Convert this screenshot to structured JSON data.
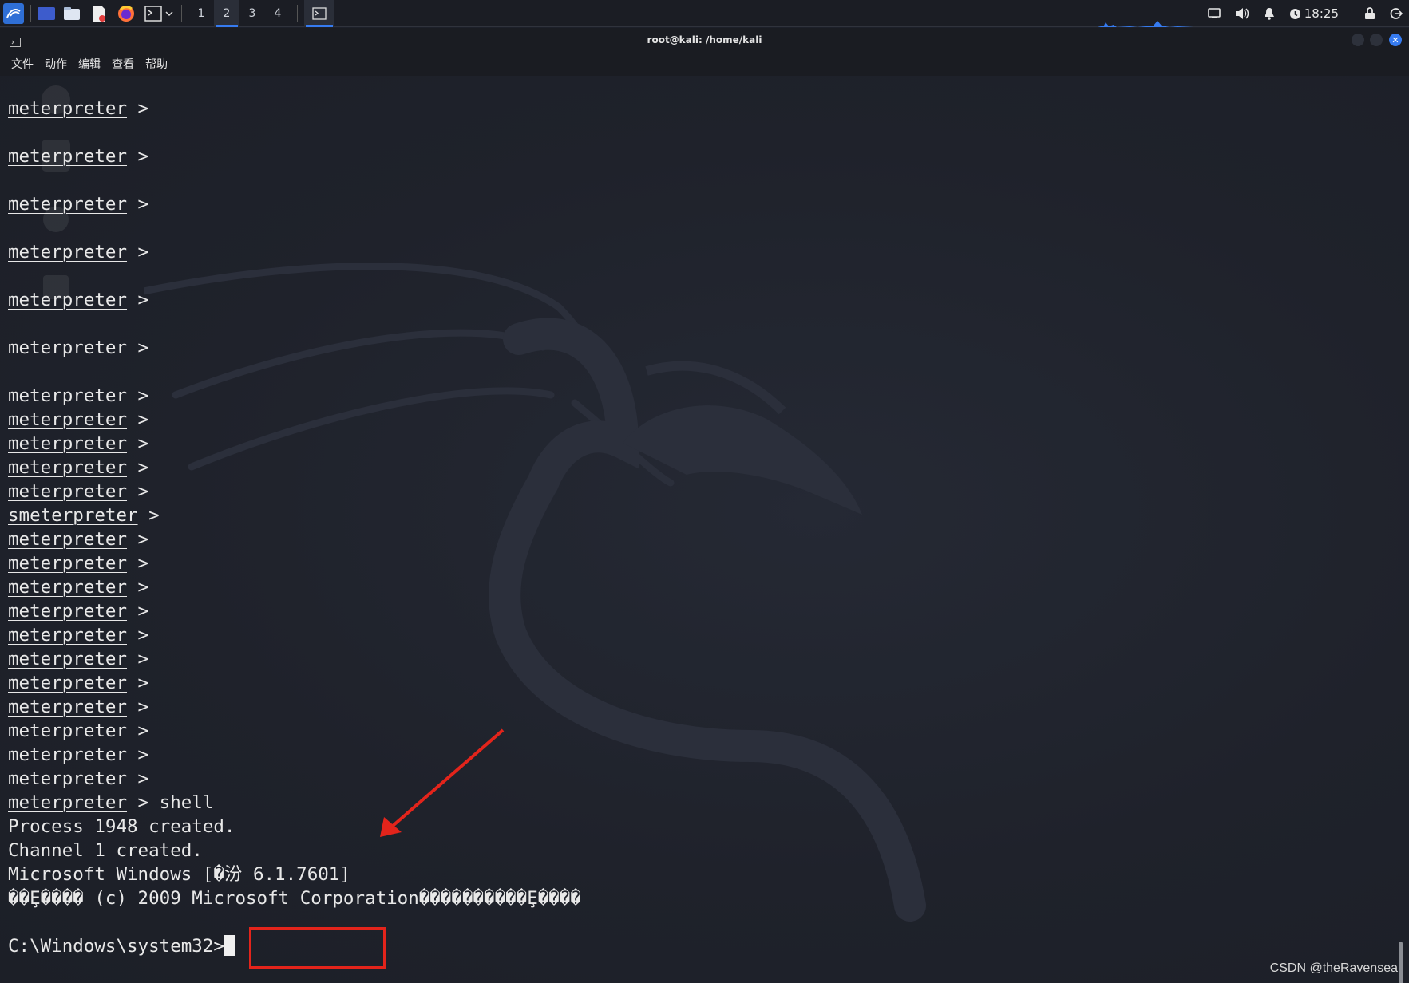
{
  "taskbar": {
    "workspaces": [
      "1",
      "2",
      "3",
      "4"
    ],
    "active_workspace": "2",
    "clock": "18:25"
  },
  "window": {
    "title": "root@kali: /home/kali",
    "menu": [
      "文件",
      "动作",
      "编辑",
      "查看",
      "帮助"
    ]
  },
  "terminal": {
    "prompt": "meterpreter",
    "lines": [
      {
        "prefix": "",
        "prompt": "meterpreter",
        "rest": " >",
        "gap": true
      },
      {
        "prefix": "",
        "prompt": "meterpreter",
        "rest": " >",
        "gap": true
      },
      {
        "prefix": "",
        "prompt": "meterpreter",
        "rest": " >",
        "gap": true
      },
      {
        "prefix": "",
        "prompt": "meterpreter",
        "rest": " >",
        "gap": true
      },
      {
        "prefix": "",
        "prompt": "meterpreter",
        "rest": " >",
        "gap": true
      },
      {
        "prefix": "",
        "prompt": "meterpreter",
        "rest": " >",
        "gap": true
      },
      {
        "prefix": "",
        "prompt": "meterpreter",
        "rest": " >"
      },
      {
        "prefix": "",
        "prompt": "meterpreter",
        "rest": " >"
      },
      {
        "prefix": "",
        "prompt": "meterpreter",
        "rest": " >"
      },
      {
        "prefix": "",
        "prompt": "meterpreter",
        "rest": " >"
      },
      {
        "prefix": "",
        "prompt": "meterpreter",
        "rest": " >"
      },
      {
        "prefix": "",
        "prompt": "smeterpreter",
        "rest": " >"
      },
      {
        "prefix": "",
        "prompt": "meterpreter",
        "rest": " >"
      },
      {
        "prefix": "",
        "prompt": "meterpreter",
        "rest": " >"
      },
      {
        "prefix": "",
        "prompt": "meterpreter",
        "rest": " >"
      },
      {
        "prefix": "",
        "prompt": "meterpreter",
        "rest": " >"
      },
      {
        "prefix": "",
        "prompt": "meterpreter",
        "rest": " >"
      },
      {
        "prefix": "",
        "prompt": "meterpreter",
        "rest": " >"
      },
      {
        "prefix": "",
        "prompt": "meterpreter",
        "rest": " >"
      },
      {
        "prefix": "",
        "prompt": "meterpreter",
        "rest": " >"
      },
      {
        "prefix": "",
        "prompt": "meterpreter",
        "rest": " >"
      },
      {
        "prefix": "",
        "prompt": "meterpreter",
        "rest": " >"
      },
      {
        "prefix": "",
        "prompt": "meterpreter",
        "rest": " >"
      },
      {
        "prefix": "",
        "prompt": "meterpreter",
        "rest": " > shell"
      },
      {
        "prefix": "Process 1948 created.",
        "prompt": "",
        "rest": ""
      },
      {
        "prefix": "Channel 1 created.",
        "prompt": "",
        "rest": ""
      },
      {
        "prefix": "Microsoft Windows [�汾 6.1.7601]",
        "prompt": "",
        "rest": ""
      },
      {
        "prefix": "��Ȩ���� (c) 2009 Microsoft Corporation����������Ȩ����",
        "prompt": "",
        "rest": "",
        "gap": true
      },
      {
        "prefix": "C:\\Windows\\system32>",
        "prompt": "",
        "rest": "",
        "cursor": true
      }
    ]
  },
  "annotation": {
    "highlighted_text": "6.1.7601]",
    "colors": {
      "box": "#e3241b",
      "arrow": "#e3241b"
    }
  },
  "watermark": "CSDN @theRavensea",
  "colors": {
    "terminal_bg": "#1e2129",
    "accent": "#367bf0",
    "text": "#e8e8e8"
  }
}
